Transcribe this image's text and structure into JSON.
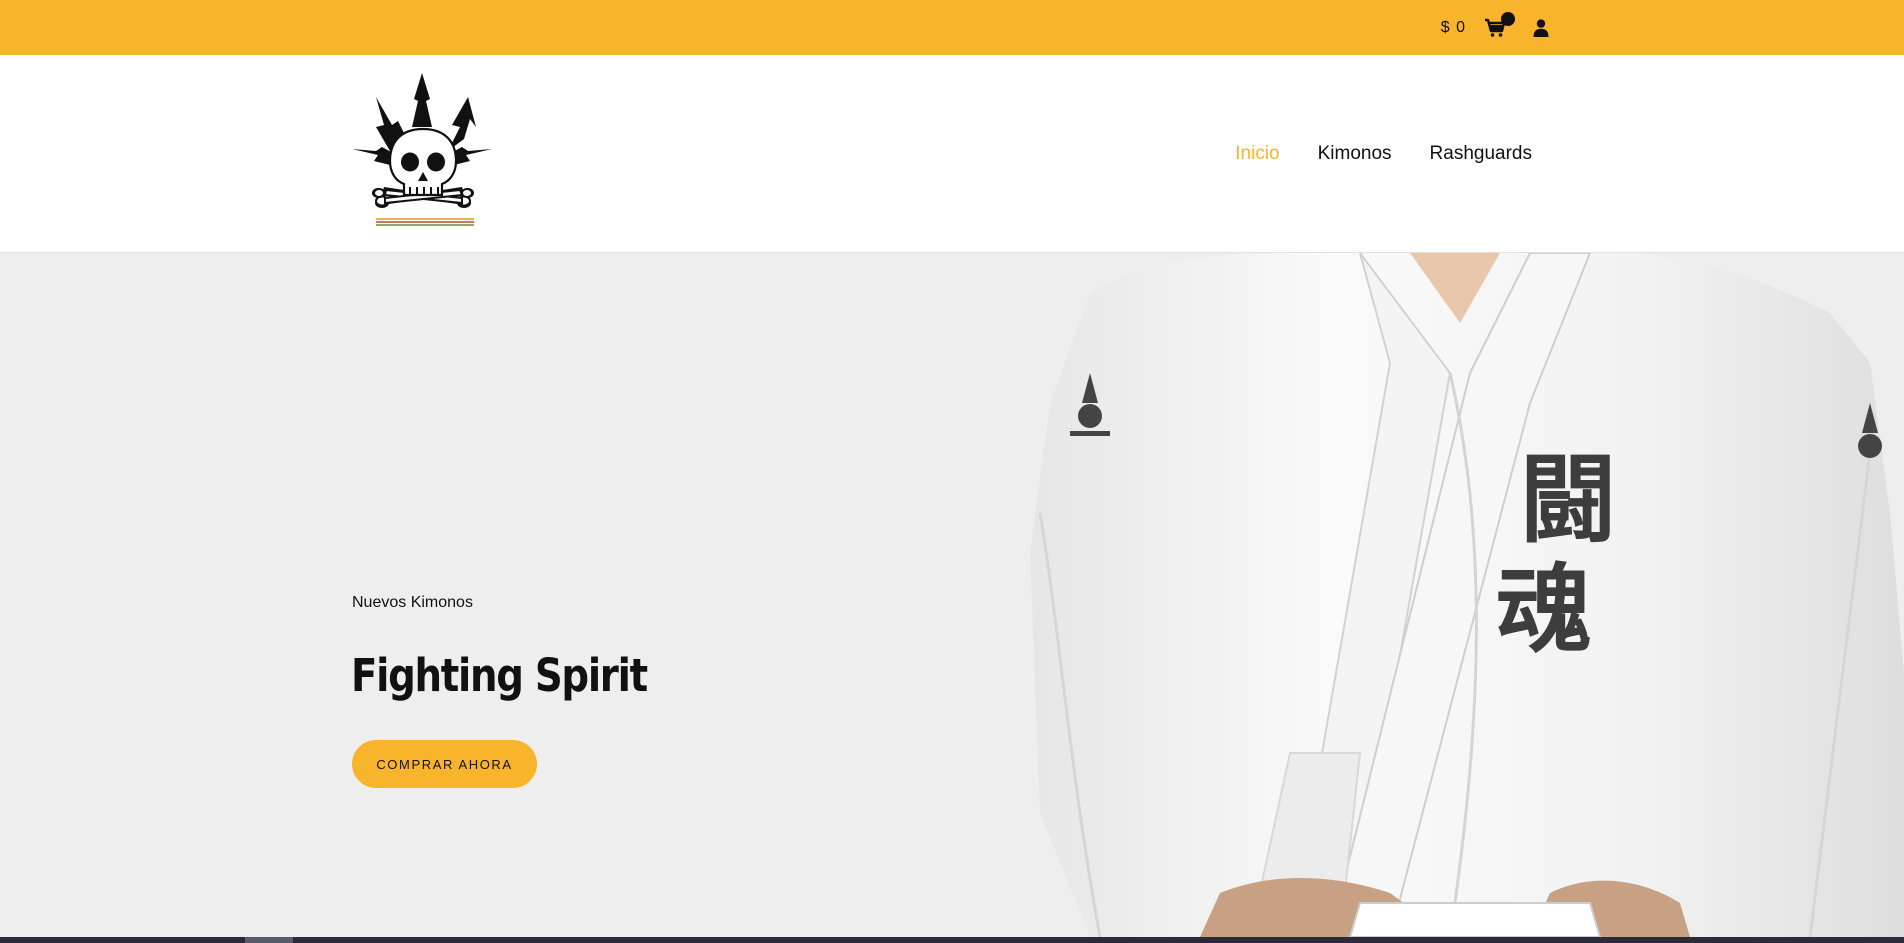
{
  "topbar": {
    "cart_total": "$ 0",
    "icons": {
      "cart": "cart-icon",
      "user": "user-icon"
    }
  },
  "header": {
    "logo": "skull-crossbones-leaf-logo",
    "nav": [
      {
        "label": "Inicio",
        "active": true
      },
      {
        "label": "Kimonos",
        "active": false
      },
      {
        "label": "Rashguards",
        "active": false
      }
    ]
  },
  "hero": {
    "subtitle": "Nuevos Kimonos",
    "title": "Fighting Spirit",
    "cta_label": "COMPRAR AHORA",
    "image": "white-kimono-photo",
    "kimono_kanji": [
      "闘",
      "魂"
    ]
  },
  "colors": {
    "accent": "#f8b42a",
    "hero_bg": "#eeeeee",
    "text": "#111111"
  }
}
